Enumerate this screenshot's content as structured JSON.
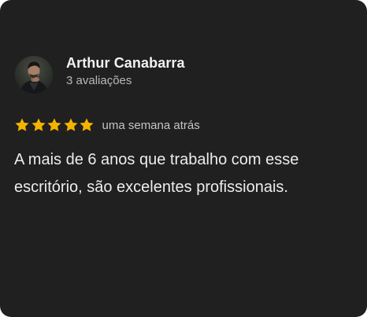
{
  "review": {
    "author": {
      "name": "Arthur Canabarra",
      "reviews_count_label": "3 avaliações",
      "avatar_icon": "user-avatar-photo"
    },
    "rating": {
      "stars": 5,
      "max_stars": 5,
      "star_color": "#f2b400"
    },
    "time_ago": "uma semana atrás",
    "text": "A mais de 6 anos que trabalho com esse escritório, são excelentes profissionais."
  },
  "colors": {
    "card_background": "#202021",
    "primary_text": "#f2f2f2",
    "secondary_text": "#b8b8b8"
  }
}
